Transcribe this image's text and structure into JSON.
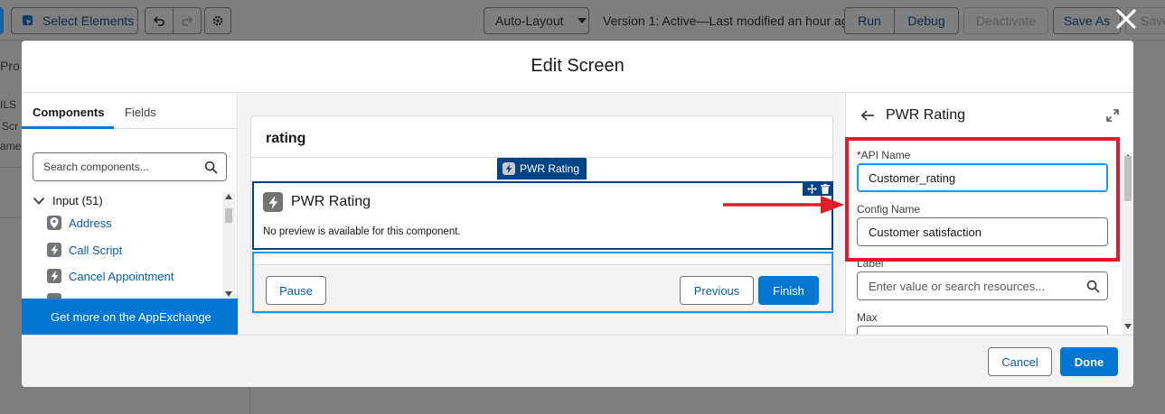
{
  "toolbar": {
    "select_elements": "Select Elements",
    "layout_mode": "Auto-Layout",
    "version_text": "Version 1: Active—Last modified an hour ago",
    "run": "Run",
    "debug": "Debug",
    "deactivate": "Deactivate",
    "save_as": "Save As",
    "save_partial": "Save"
  },
  "background": {
    "frag_pro": "Pro",
    "frag_ils": "ILS",
    "frag_scr": "Scr",
    "frag_ame": "ame:"
  },
  "modal": {
    "title": "Edit Screen",
    "cancel": "Cancel",
    "done": "Done"
  },
  "components_panel": {
    "tabs": [
      "Components",
      "Fields"
    ],
    "search_placeholder": "Search components...",
    "group": "Input (51)",
    "items": [
      "Address",
      "Call Script",
      "Cancel Appointment"
    ],
    "appexchange": "Get more on the AppExchange"
  },
  "canvas": {
    "screen_title": "rating",
    "selected_label": "PWR Rating",
    "component_title": "PWR Rating",
    "no_preview": "No preview is available for this component.",
    "pause": "Pause",
    "previous": "Previous",
    "finish": "Finish"
  },
  "properties": {
    "title": "PWR Rating",
    "api_name_required": "*",
    "api_name_label": "API Name",
    "api_name_value": "Customer_rating",
    "config_name_label": "Config Name",
    "config_name_value": "Customer satisfaction",
    "label_label": "Label",
    "label_placeholder": "Enter value or search resources...",
    "max_label": "Max"
  },
  "colors": {
    "brand": "#0176d3",
    "selection": "#014486",
    "annotation": "#e21b2a"
  }
}
